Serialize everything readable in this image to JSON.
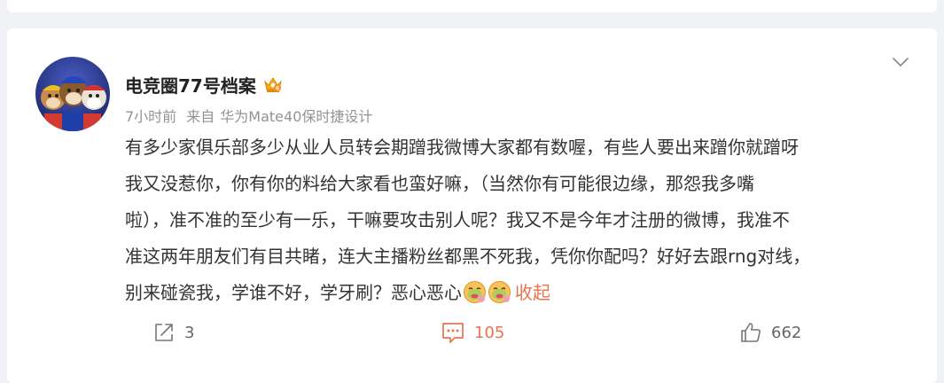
{
  "post": {
    "author": "电竞圈77号档案",
    "time": "7小时前",
    "source_prefix": "来自",
    "source": "华为Mate40保时捷设计",
    "content_lines": [
      "有多少家俱乐部多少从业人员转会期蹭我微博大家都有数喔，有些人要出来蹭你就蹭呀",
      "我又没惹你，你有你的料给大家看也蛮好嘛，（当然你有可能很边缘，那怨我多嘴",
      "啦），准不准的至少有一乐，干嘛要攻击别人呢？我又不是今年才注册的微博，我准不",
      "准这两年朋友们有目共睹，连大主播粉丝都黑不死我，凭你你配吗？好好去跟rng对线，",
      "别来碰瓷我，学谁不好，学牙刷？恶心恶心"
    ],
    "collapse_label": "收起",
    "badge_icon": "gold-crown-vip-icon",
    "emoji_icon": "nauseated-face-emoji"
  },
  "actions": {
    "forward": {
      "icon": "share-icon",
      "count": "3"
    },
    "comment": {
      "icon": "comment-icon",
      "count": "105"
    },
    "like": {
      "icon": "thumbs-up-icon",
      "count": "662"
    }
  },
  "colors": {
    "accent": "#eb7350",
    "meta_text": "#939393",
    "body_text": "#333333",
    "page_bg": "#f1f2f5"
  }
}
